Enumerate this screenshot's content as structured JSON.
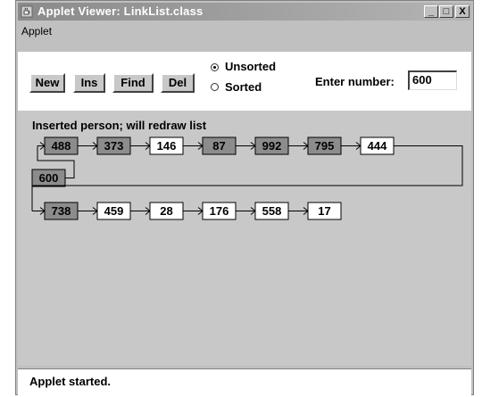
{
  "window": {
    "title": "Applet Viewer: LinkList.class"
  },
  "titlebar_buttons": {
    "minimize": "_",
    "maximize": "□",
    "close": "X"
  },
  "menu": {
    "applet": "Applet"
  },
  "toolbar": {
    "buttons": [
      "New",
      "Ins",
      "Find",
      "Del"
    ],
    "sort_options": [
      {
        "label": "Unsorted",
        "checked": true
      },
      {
        "label": "Sorted",
        "checked": false
      }
    ],
    "number_label": "Enter number:",
    "number_value": "600"
  },
  "message": "Inserted person; will redraw list",
  "list": {
    "row1": [
      {
        "value": "488",
        "highlight": true
      },
      {
        "value": "373",
        "highlight": true
      },
      {
        "value": "146",
        "highlight": false
      },
      {
        "value": "87",
        "highlight": true
      },
      {
        "value": "992",
        "highlight": true
      },
      {
        "value": "795",
        "highlight": true
      },
      {
        "value": "444",
        "highlight": false
      }
    ],
    "inserted": {
      "value": "600",
      "highlight": true
    },
    "row2": [
      {
        "value": "738",
        "highlight": true
      },
      {
        "value": "459",
        "highlight": false
      },
      {
        "value": "28",
        "highlight": false
      },
      {
        "value": "176",
        "highlight": false
      },
      {
        "value": "558",
        "highlight": false
      },
      {
        "value": "17",
        "highlight": false
      }
    ]
  },
  "colors": {
    "highlight": "#8c8c8c",
    "plain": "#ffffff",
    "applet_bg": "#c8c8c8"
  },
  "status_bar": "Applet started."
}
